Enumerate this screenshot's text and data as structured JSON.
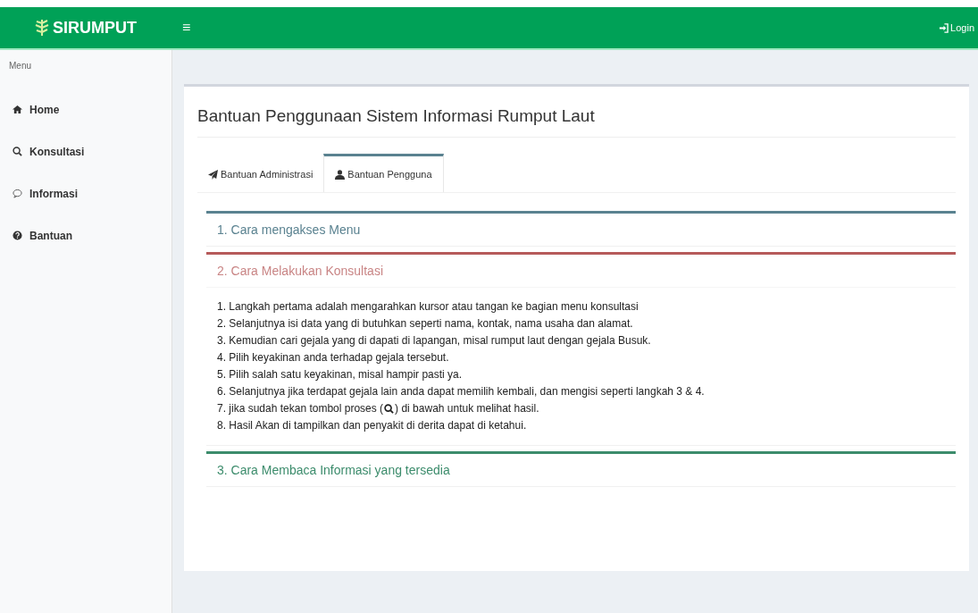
{
  "brand": "SIRUMPUT",
  "menu_toggle": "≡",
  "login": "Login",
  "sidebar": {
    "heading": "Menu",
    "items": [
      {
        "label": "Home",
        "kind": "home"
      },
      {
        "label": "Konsultasi",
        "kind": "search"
      },
      {
        "label": "Informasi",
        "kind": "chat"
      },
      {
        "label": "Bantuan",
        "kind": "help"
      }
    ]
  },
  "page_title": "Bantuan Penggunaan Sistem Informasi Rumput Laut",
  "tabs": [
    {
      "label": "Bantuan Administrasi",
      "kind": "send",
      "selected": false
    },
    {
      "label": "Bantuan Pengguna",
      "kind": "user",
      "selected": true
    }
  ],
  "panels": [
    {
      "title": "1. Cara mengakses Menu",
      "color": "#5a8290",
      "expanded": false
    },
    {
      "title": "2. Cara Melakukan Konsultasi",
      "color": "#b65a5a",
      "expanded": true,
      "steps": [
        {
          "text": "1. Langkah pertama adalah mengarahkan kursor atau tangan ke bagian menu konsultasi"
        },
        {
          "text": "2. Selanjutnya isi data yang di butuhkan seperti nama, kontak, nama usaha dan alamat."
        },
        {
          "text": "3. Kemudian cari gejala yang di dapati di lapangan, misal rumput laut dengan gejala Busuk."
        },
        {
          "text": "4. Pilih keyakinan anda terhadap gejala tersebut."
        },
        {
          "text": "5. Pilih salah satu keyakinan, misal hampir pasti ya."
        },
        {
          "text": "6. Selanjutnya jika terdapat gejala lain anda dapat memilih kembali, dan mengisi seperti langkah 3 & 4."
        },
        {
          "text": "7. jika sudah tekan tombol proses (",
          "text_after": ") di bawah untuk melihat hasil."
        },
        {
          "text": "8. Hasil Akan di tampilkan dan penyakit di derita dapat di ketahui."
        }
      ]
    },
    {
      "title": "3. Cara Membaca Informasi yang tersedia",
      "color": "#3c8c6c",
      "expanded": false
    }
  ]
}
